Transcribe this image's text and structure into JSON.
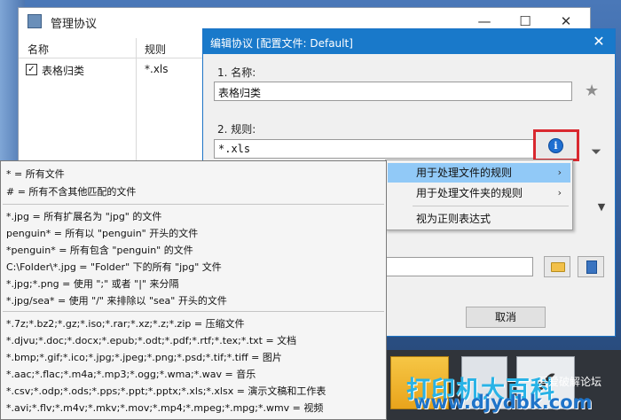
{
  "back_window": {
    "title": "管理协议",
    "controls": {
      "minimize": "—",
      "maximize": "☐",
      "close": "✕"
    },
    "columns": [
      "名称",
      "规则"
    ],
    "rows": [
      {
        "checked": true,
        "name": "表格归类",
        "rule": "*.xls"
      }
    ]
  },
  "edit_window": {
    "title": "编辑协议 [配置文件: Default]",
    "close": "✕",
    "name_label": "1. 名称:",
    "name_value": "表格归类",
    "rule_label": "2. 规则:",
    "rule_value": "*.xls",
    "cancel_button": "取消"
  },
  "context_menu": {
    "items": [
      {
        "label": "用于处理文件的规则",
        "has_submenu": true,
        "active": true
      },
      {
        "label": "用于处理文件夹的规则",
        "has_submenu": true,
        "active": false
      },
      {
        "label": "视为正则表达式",
        "has_submenu": false,
        "active": false
      }
    ]
  },
  "help": {
    "group1": [
      "* = 所有文件",
      "# = 所有不含其他匹配的文件"
    ],
    "group2": [
      "*.jpg = 所有扩展名为 \"jpg\" 的文件",
      "penguin* = 所有以 \"penguin\" 开头的文件",
      "*penguin* = 所有包含 \"penguin\" 的文件",
      "C:\\Folder\\*.jpg = \"Folder\" 下的所有 \"jpg\" 文件",
      "*.jpg;*.png = 使用 \";\" 或者 \"|\" 来分隔",
      "*.jpg/sea* = 使用 \"/\" 来排除以 \"sea\" 开头的文件"
    ],
    "group3": [
      "*.7z;*.bz2;*.gz;*.iso;*.rar;*.xz;*.z;*.zip = 压缩文件",
      "*.djvu;*.doc;*.docx;*.epub;*.odt;*.pdf;*.rtf;*.tex;*.txt = 文档",
      "*.bmp;*.gif;*.ico;*.jpg;*.jpeg;*.png;*.psd;*.tif;*.tiff = 图片",
      "*.aac;*.flac;*.m4a;*.mp3;*.ogg;*.wma;*.wav = 音乐",
      "*.csv;*.odp;*.ods;*.pps;*.ppt;*.pptx;*.xls;*.xlsx = 演示文稿和工作表",
      "*.avi;*.flv;*.m4v;*.mkv;*.mov;*.mp4;*.mpeg;*.mpg;*.wmv = 视频"
    ]
  },
  "watermark": {
    "main": "打印机大百科",
    "sub": "吾爱破解论坛",
    "url": "www.djydbk.com"
  },
  "desktop": {
    "tile_glyph": "✔"
  },
  "colors": {
    "titlebar_active": "#1979ca",
    "highlight_box": "#d9282f",
    "menu_active": "#91c9f7",
    "info_icon": "#1f6fd1"
  }
}
